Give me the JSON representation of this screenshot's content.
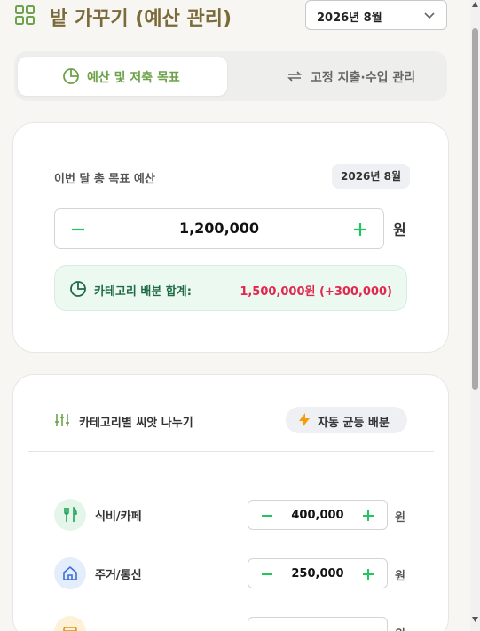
{
  "header": {
    "title": "밭 가꾸기 (예산 관리)",
    "month_selected": "2026년 8월"
  },
  "tabs": [
    {
      "label": "예산 및 저축 목표",
      "active": true
    },
    {
      "label": "고정 지출·수입 관리",
      "active": false
    }
  ],
  "budget": {
    "label": "이번 달 총 목표 예산",
    "month_badge": "2026년 8월",
    "amount": "1,200,000",
    "unit": "원",
    "allocation_label": "카테고리 배분 합계:",
    "allocation_value": "1,500,000원 (+300,000)"
  },
  "categories_section": {
    "title": "카테고리별 씨앗 나누기",
    "auto_button": "자동 균등 배분",
    "rows": [
      {
        "name": "식비/카페",
        "amount": "400,000",
        "unit": "원",
        "icon": "utensils-icon"
      },
      {
        "name": "주거/통신",
        "amount": "250,000",
        "unit": "원",
        "icon": "home-icon"
      },
      {
        "name": "",
        "amount": "",
        "unit": "원",
        "icon": "wallet-icon"
      }
    ]
  },
  "colors": {
    "brand": "#7b6a3a",
    "accent_green": "#6da24b",
    "plus_minus": "#22c55e",
    "alert_red": "#e0284f"
  }
}
